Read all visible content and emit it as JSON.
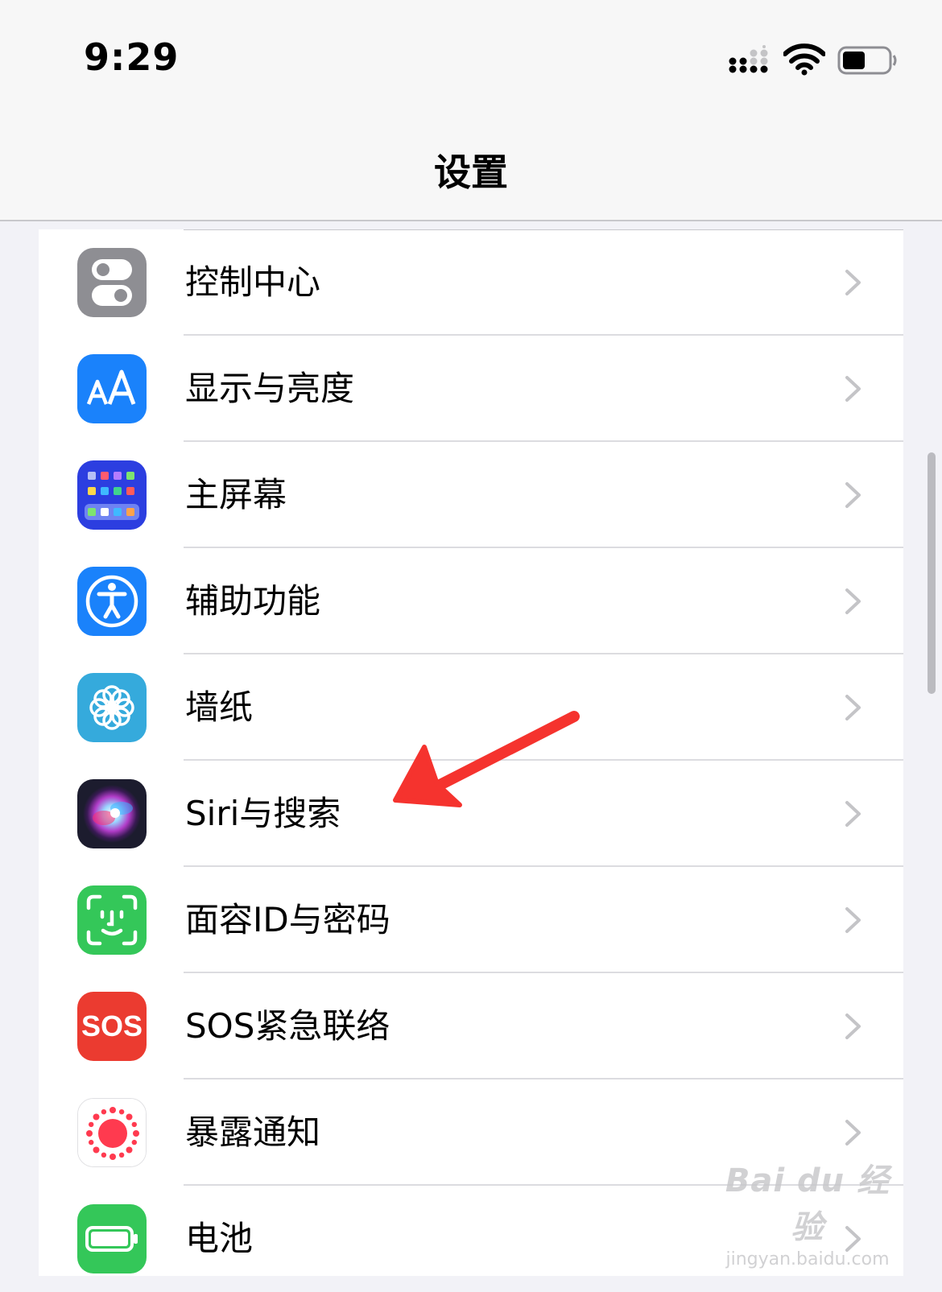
{
  "status_bar": {
    "time": "9:29"
  },
  "nav": {
    "title": "设置"
  },
  "settings_items": [
    {
      "label": "控制中心",
      "icon": "control-center-icon",
      "icon_color": "#8e8e93"
    },
    {
      "label": "显示与亮度",
      "icon": "display-brightness-icon",
      "icon_color": "#1a82fb"
    },
    {
      "label": "主屏幕",
      "icon": "home-screen-icon",
      "icon_color": "#2c3ee0"
    },
    {
      "label": "辅助功能",
      "icon": "accessibility-icon",
      "icon_color": "#1a82fb"
    },
    {
      "label": "墙纸",
      "icon": "wallpaper-icon",
      "icon_color": "#35aadc"
    },
    {
      "label": "Siri与搜索",
      "icon": "siri-icon",
      "icon_color": "#1c1c2e"
    },
    {
      "label": "面容ID与密码",
      "icon": "face-id-icon",
      "icon_color": "#34c759"
    },
    {
      "label": "SOS紧急联络",
      "icon": "sos-icon",
      "icon_color": "#eb3b30",
      "icon_text": "SOS"
    },
    {
      "label": "暴露通知",
      "icon": "exposure-notification-icon",
      "icon_color": "#ff3a4f"
    },
    {
      "label": "电池",
      "icon": "battery-settings-icon",
      "icon_color": "#34c759"
    }
  ],
  "annotation": {
    "icon": "red-arrow-icon",
    "color": "#f5332e"
  },
  "watermark": {
    "logo": "Bai du 经验",
    "url": "jingyan.baidu.com"
  }
}
